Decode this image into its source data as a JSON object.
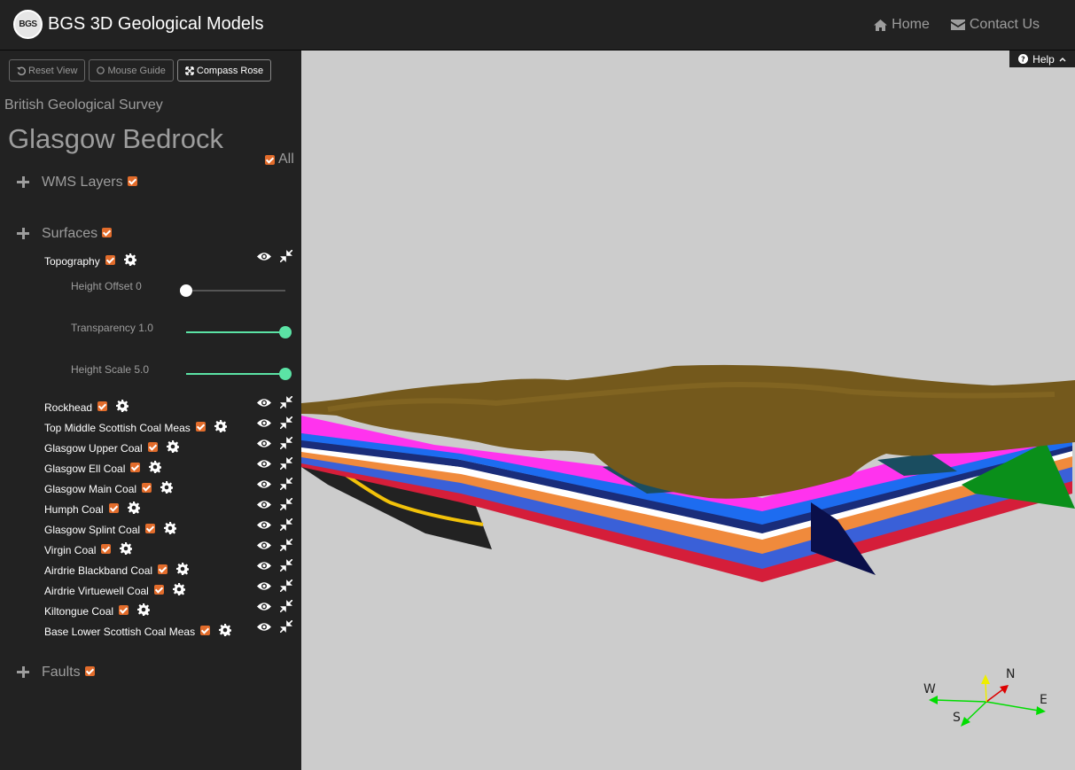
{
  "navbar": {
    "logo_text": "BGS",
    "title": "BGS 3D Geological Models",
    "links": [
      {
        "label": "Home",
        "icon": "home-icon"
      },
      {
        "label": "Contact Us",
        "icon": "envelope-icon"
      }
    ]
  },
  "toolbar": {
    "reset_view": "Reset View",
    "mouse_guide": "Mouse Guide",
    "compass_rose": "Compass Rose"
  },
  "sidebar": {
    "organisation": "British Geological Survey",
    "model_title": "Glasgow Bedrock",
    "all_label": "All",
    "groups": {
      "wms": "WMS Layers",
      "surfaces": "Surfaces",
      "faults": "Faults"
    },
    "topography": {
      "label": "Topography",
      "height_offset": "Height Offset 0",
      "transparency": "Transparency 1.0",
      "height_scale": "Height Scale 5.0",
      "height_offset_level": 0.0,
      "transparency_level": 1.0,
      "height_scale_level": 1.0
    },
    "surfaces": [
      "Rockhead",
      "Top Middle Scottish Coal Meas",
      "Glasgow Upper Coal",
      "Glasgow Ell Coal",
      "Glasgow Main Coal",
      "Humph Coal",
      "Glasgow Splint Coal",
      "Virgin Coal",
      "Airdrie Blackband Coal",
      "Airdrie Virtuewell Coal",
      "Kiltongue Coal",
      "Base Lower Scottish Coal Meas"
    ]
  },
  "viewer": {
    "help_label": "Help",
    "compass": {
      "n": "N",
      "s": "S",
      "e": "E",
      "w": "W"
    }
  },
  "colors": {
    "navbar_bg": "#222222",
    "checkbox": "#e26c2b",
    "slider_accent": "#5be3a5",
    "viewer_bg": "#cccccc",
    "topography": "#74591c",
    "magenta_layer": "#ff33ee",
    "fault_green": "#0a8f1a"
  }
}
